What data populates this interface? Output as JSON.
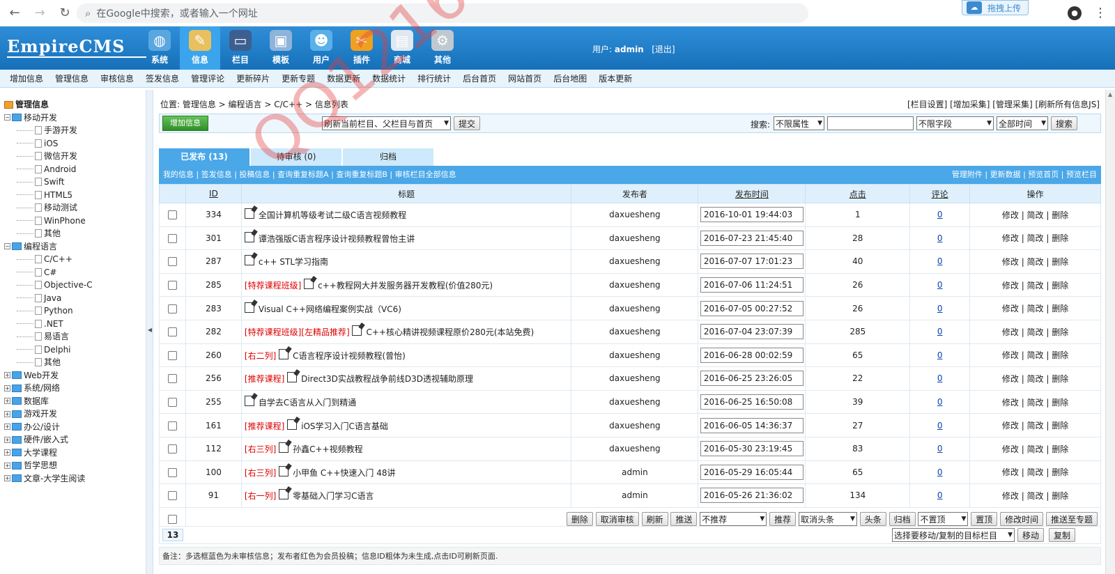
{
  "browser": {
    "omnibox_placeholder": "在Google中搜索，或者输入一个网址",
    "upload_label": "拖拽上传"
  },
  "header": {
    "logo": "EmpireCMS",
    "nav": [
      {
        "label": "系统",
        "icon": "globe-icon",
        "color": "#5aa7e0"
      },
      {
        "label": "信息",
        "icon": "edit-icon",
        "color": "#e8c060"
      },
      {
        "label": "栏目",
        "icon": "folder-icon",
        "color": "#3c5f8f"
      },
      {
        "label": "模板",
        "icon": "window-icon",
        "color": "#8fb4d9"
      },
      {
        "label": "用户",
        "icon": "user-icon",
        "color": "#5ab0e8"
      },
      {
        "label": "插件",
        "icon": "tools-icon",
        "color": "#f0a020"
      },
      {
        "label": "商城",
        "icon": "card-icon",
        "color": "#e0e8f0"
      },
      {
        "label": "其他",
        "icon": "gear-icon",
        "color": "#c0c8d0"
      }
    ],
    "user_label": "用户:",
    "user_name": "admin",
    "logout": "[退出]"
  },
  "submenu": [
    "增加信息",
    "管理信息",
    "审核信息",
    "签发信息",
    "管理评论",
    "更新碎片",
    "更新专题",
    "数据更新",
    "数据统计",
    "排行统计",
    "后台首页",
    "网站首页",
    "后台地图",
    "版本更新"
  ],
  "tree": [
    {
      "label": "管理信息",
      "type": "root"
    },
    {
      "label": "移动开发",
      "type": "open"
    },
    {
      "label": "手游开发",
      "type": "leaf"
    },
    {
      "label": "iOS",
      "type": "leaf"
    },
    {
      "label": "微信开发",
      "type": "leaf"
    },
    {
      "label": "Android",
      "type": "leaf"
    },
    {
      "label": "Swift",
      "type": "leaf"
    },
    {
      "label": "HTML5",
      "type": "leaf"
    },
    {
      "label": "移动测试",
      "type": "leaf"
    },
    {
      "label": "WinPhone",
      "type": "leaf"
    },
    {
      "label": "其他",
      "type": "leaf"
    },
    {
      "label": "编程语言",
      "type": "open"
    },
    {
      "label": "C/C++",
      "type": "leaf"
    },
    {
      "label": "C#",
      "type": "leaf"
    },
    {
      "label": "Objective-C",
      "type": "leaf"
    },
    {
      "label": "Java",
      "type": "leaf"
    },
    {
      "label": "Python",
      "type": "leaf"
    },
    {
      "label": ".NET",
      "type": "leaf"
    },
    {
      "label": "易语言",
      "type": "leaf"
    },
    {
      "label": "Delphi",
      "type": "leaf"
    },
    {
      "label": "其他",
      "type": "leaf"
    },
    {
      "label": "Web开发",
      "type": "closed"
    },
    {
      "label": "系统/网络",
      "type": "closed"
    },
    {
      "label": "数据库",
      "type": "closed"
    },
    {
      "label": "游戏开发",
      "type": "closed"
    },
    {
      "label": "办公/设计",
      "type": "closed"
    },
    {
      "label": "硬件/嵌入式",
      "type": "closed"
    },
    {
      "label": "大学课程",
      "type": "closed"
    },
    {
      "label": "哲学思想",
      "type": "closed"
    },
    {
      "label": "文章-大学生阅读",
      "type": "closed"
    }
  ],
  "main": {
    "location": "位置:  管理信息 > 编程语言 > C/C++ > 信息列表",
    "toplinks": "[栏目设置] [增加采集] [管理采集] [刷新所有信息JS]",
    "add_button": "增加信息",
    "refresh_select": "刷新当前栏目、父栏目与首页",
    "submit": "提交",
    "search_label": "搜索:",
    "attr_select": "不限属性",
    "search_value": "",
    "field_select": "不限字段",
    "time_select": "全部时间",
    "search_button": "搜索",
    "tabs": [
      "已发布 (13)",
      "待审核 (0)",
      "归档"
    ],
    "tabline_left": "我的信息 | 签发信息 | 投稿信息 | 查询重复标题A | 查询重复标题B | 审核栏目全部信息",
    "tabline_right": "管理附件 | 更新数据 | 预览首页 | 预览栏目",
    "columns": {
      "id": "ID",
      "title": "标题",
      "publisher": "发布者",
      "time": "发布时间",
      "hits": "点击",
      "comments": "评论",
      "ops": "操作"
    },
    "rows": [
      {
        "id": "334",
        "tag": "",
        "title": "全国计算机等级考试二级C语言视频教程",
        "publisher": "daxuesheng",
        "time": "2016-10-01 19:44:03",
        "hits": "1",
        "comments": "0",
        "ops": "修改 | 简改 | 删除"
      },
      {
        "id": "301",
        "tag": "",
        "title": "谭浩强版C语言程序设计视频教程曾怡主讲",
        "publisher": "daxuesheng",
        "time": "2016-07-23 21:45:40",
        "hits": "28",
        "comments": "0",
        "ops": "修改 | 简改 | 删除"
      },
      {
        "id": "287",
        "tag": "",
        "title": "c++ STL学习指南",
        "publisher": "daxuesheng",
        "time": "2016-07-07 17:01:23",
        "hits": "40",
        "comments": "0",
        "ops": "修改 | 简改 | 删除"
      },
      {
        "id": "285",
        "tag": "[特荐课程班级]",
        "title": "c++教程网大并发服务器开发教程(价值280元)",
        "publisher": "daxuesheng",
        "time": "2016-07-06 11:24:51",
        "hits": "26",
        "comments": "0",
        "ops": "修改 | 简改 | 删除"
      },
      {
        "id": "283",
        "tag": "",
        "title": "Visual C++网络编程案例实战（VC6)",
        "publisher": "daxuesheng",
        "time": "2016-07-05 00:27:52",
        "hits": "26",
        "comments": "0",
        "ops": "修改 | 简改 | 删除"
      },
      {
        "id": "282",
        "tag": "[特荐课程班级][左精品推荐]",
        "title": "C++核心精讲视频课程原价280元(本站免费)",
        "publisher": "daxuesheng",
        "time": "2016-07-04 23:07:39",
        "hits": "285",
        "comments": "0",
        "ops": "修改 | 简改 | 删除"
      },
      {
        "id": "260",
        "tag": "[右二列]",
        "title": "C语言程序设计视频教程(曾怡)",
        "publisher": "daxuesheng",
        "time": "2016-06-28 00:02:59",
        "hits": "65",
        "comments": "0",
        "ops": "修改 | 简改 | 删除"
      },
      {
        "id": "256",
        "tag": "[推荐课程]",
        "title": "Direct3D实战教程战争前线D3D透视辅助原理",
        "publisher": "daxuesheng",
        "time": "2016-06-25 23:26:05",
        "hits": "22",
        "comments": "0",
        "ops": "修改 | 简改 | 删除"
      },
      {
        "id": "255",
        "tag": "",
        "title": "自学去C语言从入门到精通",
        "publisher": "daxuesheng",
        "time": "2016-06-25 16:50:08",
        "hits": "39",
        "comments": "0",
        "ops": "修改 | 简改 | 删除"
      },
      {
        "id": "161",
        "tag": "[推荐课程]",
        "title": "iOS学习入门C语言基础",
        "publisher": "daxuesheng",
        "time": "2016-06-05 14:36:37",
        "hits": "27",
        "comments": "0",
        "ops": "修改 | 简改 | 删除"
      },
      {
        "id": "112",
        "tag": "[右三列]",
        "title": "孙鑫C++视频教程",
        "publisher": "daxuesheng",
        "time": "2016-05-30 23:19:45",
        "hits": "83",
        "comments": "0",
        "ops": "修改 | 简改 | 删除"
      },
      {
        "id": "100",
        "tag": "[右三列]",
        "title": "小甲鱼 C++快速入门 48讲",
        "publisher": "admin",
        "time": "2016-05-29 16:05:44",
        "hits": "65",
        "comments": "0",
        "ops": "修改 | 简改 | 删除"
      },
      {
        "id": "91",
        "tag": "[右一列]",
        "title": "零基础入门学习C语言",
        "publisher": "admin",
        "time": "2016-05-26 21:36:02",
        "hits": "134",
        "comments": "0",
        "ops": "修改 | 简改 | 删除"
      }
    ],
    "bulk": {
      "delete": "删除",
      "unapprove": "取消审核",
      "refresh": "刷新",
      "push": "推送",
      "push_select": "不推荐",
      "recommend": "推荐",
      "headline_select": "取消头条",
      "headline": "头条",
      "archive": "归档",
      "top_select": "不置顶",
      "settop": "置顶",
      "modtime": "修改时间",
      "totopic": "推送至专题"
    },
    "pager_num": "13",
    "move_select": "选择要移动/复制的目标栏目",
    "move": "移动",
    "copy": "复制",
    "note": "备注：多选框蓝色为未审核信息；发布者红色为会员投稿；信息ID粗体为未生成,点击ID可刷新页面."
  },
  "watermark": "QQ1216714825"
}
